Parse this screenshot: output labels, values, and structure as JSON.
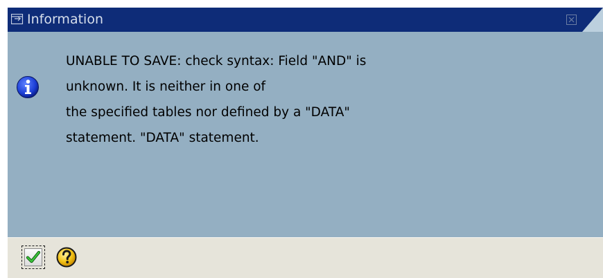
{
  "dialog": {
    "title": "Information",
    "message_lines": [
      "UNABLE TO SAVE: check syntax: Field \"AND\" is",
      "unknown. It is neither in one of",
      "the specified tables nor defined by a \"DATA\"",
      "statement. \"DATA\" statement."
    ],
    "icons": {
      "title": "dialog-window-icon",
      "close": "close-icon",
      "info": "info-icon",
      "ok": "checkmark-icon",
      "help": "question-mark-icon"
    },
    "colors": {
      "titlebar": "#0e2c78",
      "body": "#94afc2",
      "footer": "#e6e4da",
      "info_icon": "#1c3fd6",
      "check": "#1f9a1f",
      "help": "#f3c316"
    }
  }
}
